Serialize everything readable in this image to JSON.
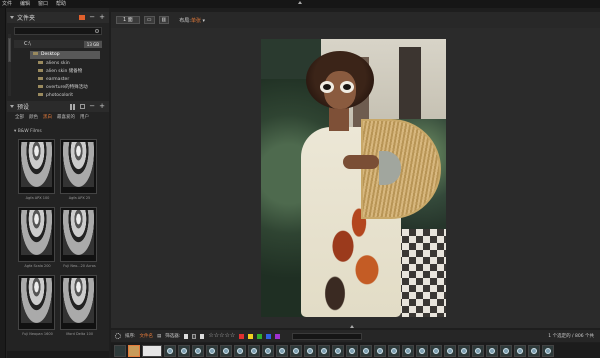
{
  "menu": [
    "文件",
    "编辑",
    "窗口",
    "帮助"
  ],
  "folders_panel": {
    "title": "文件夹",
    "drive": {
      "label": "C:\\",
      "size": "13 GB"
    },
    "items": [
      {
        "label": "Desktop",
        "selected": true
      },
      {
        "label": "aliens skin",
        "selected": false
      },
      {
        "label": "alien skin 储备物",
        "selected": false
      },
      {
        "label": "earmaster",
        "selected": false
      },
      {
        "label": "overture的特殊活动",
        "selected": false
      },
      {
        "label": "photocolorit",
        "selected": false
      }
    ]
  },
  "presets_panel": {
    "title": "预设",
    "tabs": [
      {
        "label": "全部",
        "active": false
      },
      {
        "label": "颜色",
        "active": false
      },
      {
        "label": "黑白",
        "active": true
      },
      {
        "label": "最喜爱的",
        "active": false
      },
      {
        "label": "用户",
        "active": false
      }
    ],
    "category": "B&W Films",
    "thumbnails": [
      {
        "caption": "Agfa APX 100"
      },
      {
        "caption": "Agfa APX 25"
      },
      {
        "caption": "Agfa Scala 200"
      },
      {
        "caption": "Fuji Neo...20 Acros"
      },
      {
        "caption": "Fuji Neopan 1600"
      },
      {
        "caption": "Ilford Delta 100"
      }
    ]
  },
  "viewer": {
    "fit_button": "1 面",
    "layout_label": "布局:",
    "layout_value": "单张"
  },
  "bottom_toolbar": {
    "sort_label": "排序:",
    "sort_value": "文件名",
    "filter_label": "筛选器:",
    "stars": "☆☆☆☆☆",
    "colors": [
      "#e03030",
      "#f0d020",
      "#30b030",
      "#3060e0",
      "#a030d0"
    ],
    "count": "1 个选定的 / 806 个共"
  },
  "filmstrip": {
    "count": 28
  }
}
